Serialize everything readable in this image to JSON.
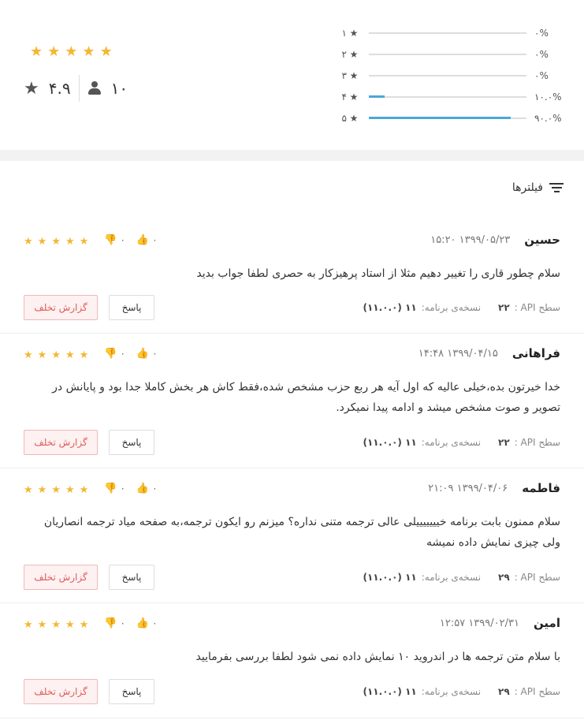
{
  "summary": {
    "rating": "۴.۹",
    "raters": "۱۰",
    "big_stars": [
      "★",
      "★",
      "★",
      "★",
      "★"
    ],
    "histogram": [
      {
        "level": "۱",
        "pct": "۰%",
        "fill": 0
      },
      {
        "level": "۲",
        "pct": "۰%",
        "fill": 0
      },
      {
        "level": "۳",
        "pct": "۰%",
        "fill": 0
      },
      {
        "level": "۴",
        "pct": "۱۰.۰%",
        "fill": 0.1
      },
      {
        "level": "۵",
        "pct": "۹۰.۰%",
        "fill": 0.9
      }
    ],
    "accent_color": "#4aa8d4",
    "star_color": "#f5b731"
  },
  "filter": {
    "label": "فیلترها"
  },
  "labels": {
    "report": "گزارش تخلف",
    "reply": "پاسخ",
    "api": "سطح API :",
    "version": "نسخه‌ی برنامه:"
  },
  "reviews": [
    {
      "name": "حسین",
      "date": "۱۳۹۹/۰۵/۲۳ ۱۵:۲۰",
      "likes": "۰",
      "dislikes": "۰",
      "text": "سلام چطور قاری را تغییر دهیم مثلا از استاد پرهیزکار به حصری لطفا جواب بدید",
      "api": "۲۲",
      "version": "۱۱ (۱۱.۰.۰)"
    },
    {
      "name": "فراهانی",
      "date": "۱۳۹۹/۰۴/۱۵ ۱۴:۴۸",
      "likes": "۰",
      "dislikes": "۰",
      "text": "خدا خیرتون بده،خیلی عالیه که اول آیه هر ربع حزب مشخص شده،فقط کاش هر بخش کاملا جدا بود و پایانش در تصویر و صوت مشخص میشد و ادامه پیدا نمیکرد.",
      "api": "۲۲",
      "version": "۱۱ (۱۱.۰.۰)"
    },
    {
      "name": "فاطمه",
      "date": "۱۳۹۹/۰۴/۰۶ ۲۱:۰۹",
      "likes": "۰",
      "dislikes": "۰",
      "text": "سلام ممنون بابت برنامه خیییییییلی عالی ترجمه متنی نداره؟ میزنم رو ایکون ترجمه،به صفحه میاد ترجمه انصاریان ولی چیزی نمایش داده نمیشه",
      "api": "۲۹",
      "version": "۱۱ (۱۱.۰.۰)"
    },
    {
      "name": "امین",
      "date": "۱۳۹۹/۰۲/۳۱ ۱۲:۵۷",
      "likes": "۰",
      "dislikes": "۰",
      "text": "با سلام متن ترجمه ها در اندروید ۱۰ نمایش داده نمی شود لطفا بررسی بفرمایید",
      "api": "۲۹",
      "version": "۱۱ (۱۱.۰.۰)"
    }
  ]
}
